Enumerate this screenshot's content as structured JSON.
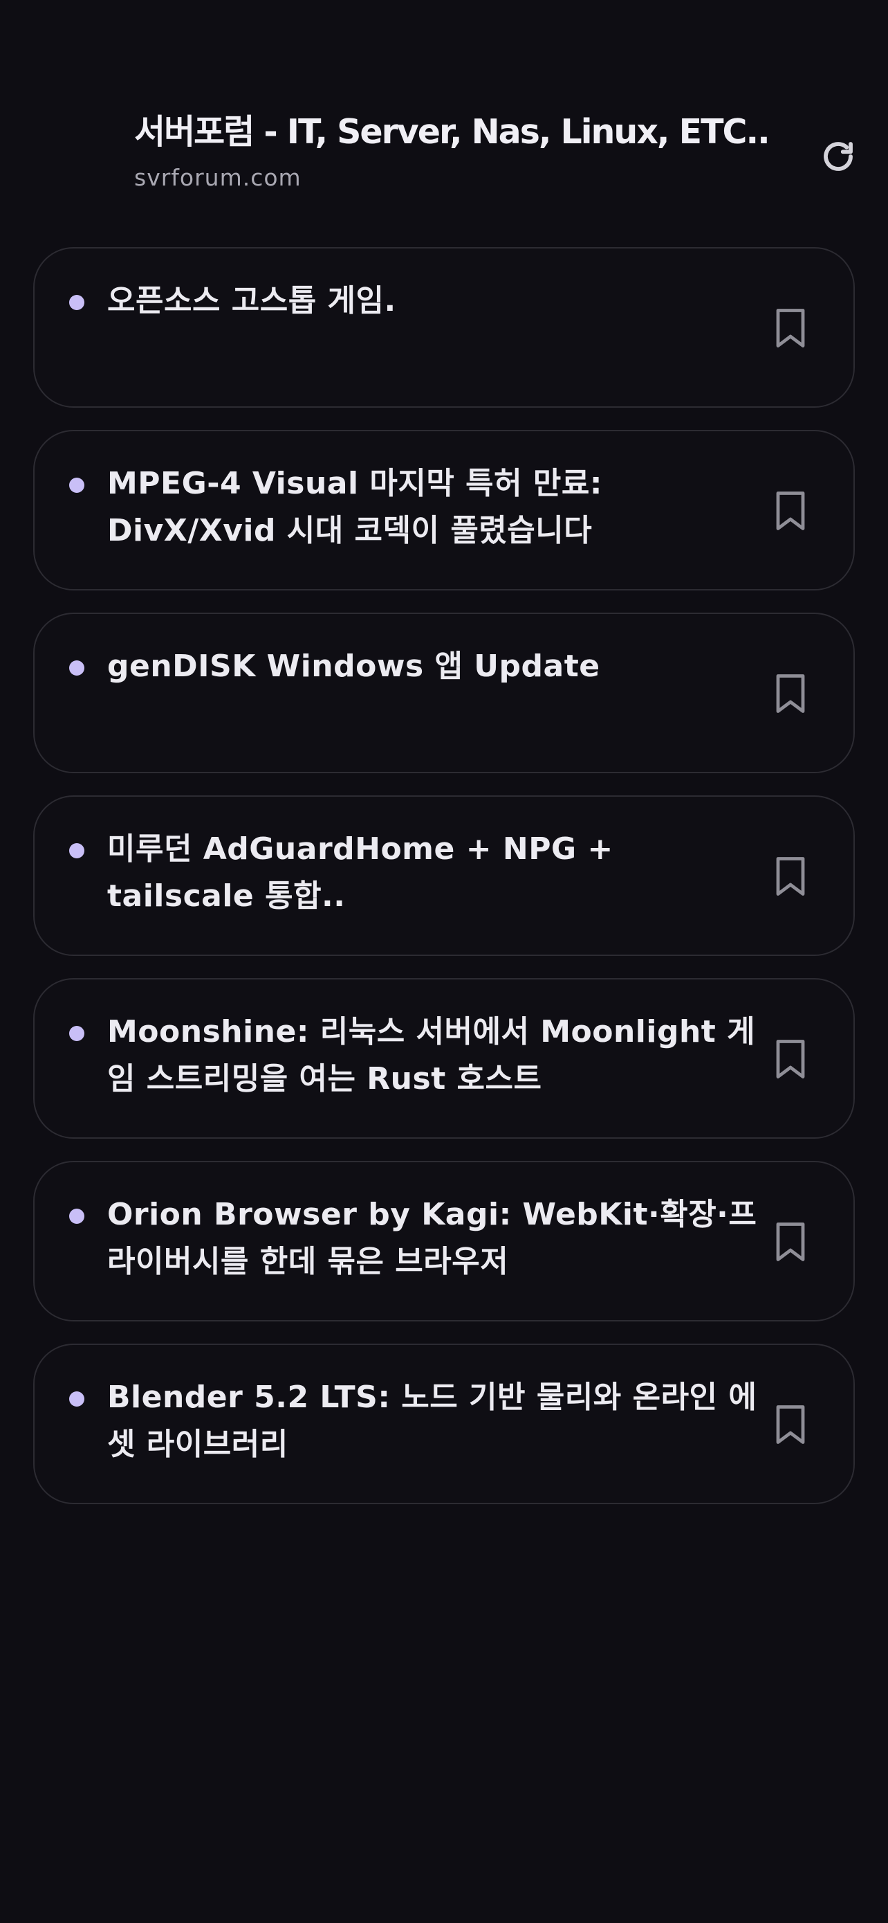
{
  "header": {
    "title": "서버포럼 - IT, Server, Nas, Linux, ETC..",
    "subtitle": "svrforum.com",
    "refresh_icon": "refresh-icon"
  },
  "colors": {
    "background": "#0e0d13",
    "card_border": "#2c2b32",
    "accent_dot": "#c9bff7",
    "text": "#ecebf1",
    "muted": "#a9a8b2"
  },
  "feed": {
    "items": [
      {
        "title": "오픈소스 고스톱 게임.",
        "bookmark_icon": "bookmark-icon"
      },
      {
        "title": "MPEG-4 Visual 마지막 특허 만료: DivX/Xvid 시대 코덱이 풀렸습니다",
        "bookmark_icon": "bookmark-icon"
      },
      {
        "title": "genDISK Windows 앱 Update",
        "bookmark_icon": "bookmark-icon"
      },
      {
        "title": "미루던 AdGuardHome + NPG + tailscale 통합..",
        "bookmark_icon": "bookmark-icon"
      },
      {
        "title": "Moonshine: 리눅스 서버에서 Moonlight 게임 스트리밍을 여는 Rust 호스트",
        "bookmark_icon": "bookmark-icon"
      },
      {
        "title": "Orion Browser by Kagi: WebKit·확장·프라이버시를 한데 묶은 브라우저",
        "bookmark_icon": "bookmark-icon"
      },
      {
        "title": "Blender 5.2 LTS: 노드 기반 물리와 온라인 에셋 라이브러리",
        "bookmark_icon": "bookmark-icon"
      }
    ]
  }
}
